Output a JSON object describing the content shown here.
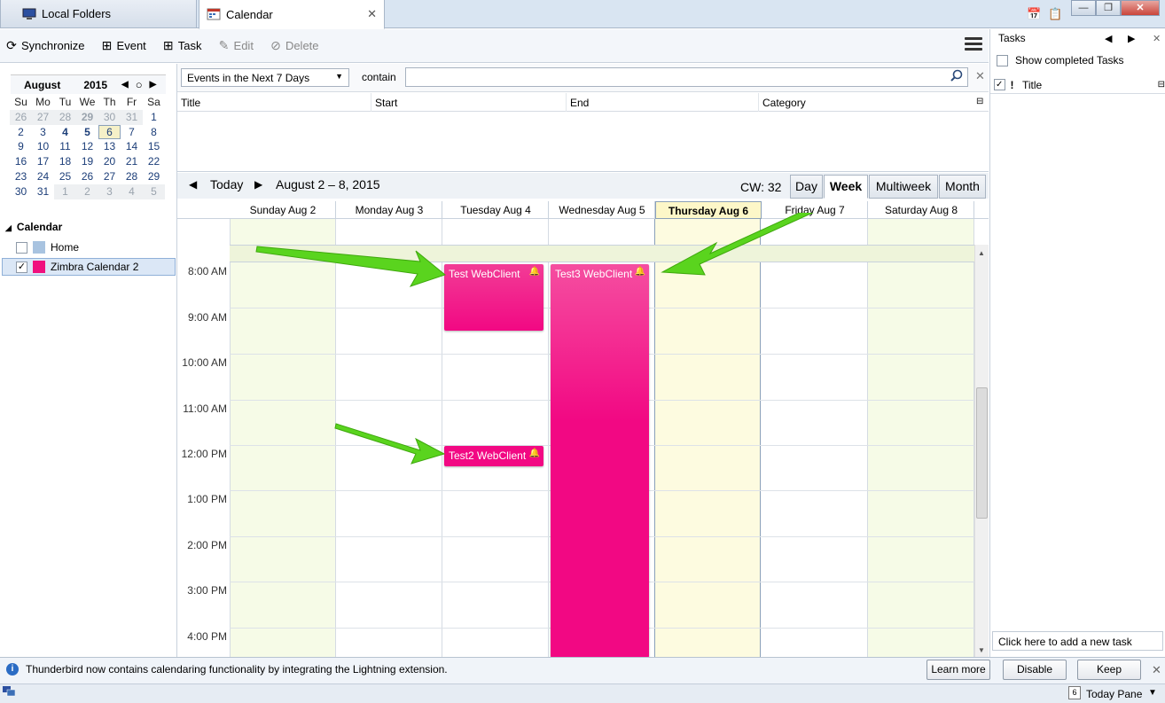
{
  "tabs": [
    {
      "label": "Local Folders",
      "icon": "computer-icon"
    },
    {
      "label": "Calendar",
      "icon": "calendar-icon"
    }
  ],
  "toolbar": {
    "synchronize": "Synchronize",
    "event": "Event",
    "task": "Task",
    "edit": "Edit",
    "delete": "Delete"
  },
  "minicalendar": {
    "month": "August",
    "year": "2015",
    "weekdays": [
      "Su",
      "Mo",
      "Tu",
      "We",
      "Th",
      "Fr",
      "Sa"
    ],
    "weeks": [
      [
        "26",
        "27",
        "28",
        "29",
        "30",
        "31",
        "1"
      ],
      [
        "2",
        "3",
        "4",
        "5",
        "6",
        "7",
        "8"
      ],
      [
        "9",
        "10",
        "11",
        "12",
        "13",
        "14",
        "15"
      ],
      [
        "16",
        "17",
        "18",
        "19",
        "20",
        "21",
        "22"
      ],
      [
        "23",
        "24",
        "25",
        "26",
        "27",
        "28",
        "29"
      ],
      [
        "30",
        "31",
        "1",
        "2",
        "3",
        "4",
        "5"
      ]
    ],
    "today": "6"
  },
  "calendars": {
    "header": "Calendar",
    "items": [
      {
        "name": "Home",
        "color": "#a8c3e0",
        "checked": false
      },
      {
        "name": "Zimbra Calendar 2",
        "color": "#f0107e",
        "checked": true
      }
    ]
  },
  "filter": {
    "selected": "Events in the Next 7 Days",
    "contain_label": "contain",
    "search_value": ""
  },
  "list_columns": [
    "Title",
    "Start",
    "End",
    "Category"
  ],
  "nav": {
    "today_label": "Today",
    "range": "August 2 – 8, 2015",
    "cw": "CW: 32",
    "views": [
      "Day",
      "Week",
      "Multiweek",
      "Month"
    ],
    "selected_view": "Week"
  },
  "days": [
    "Sunday Aug 2",
    "Monday Aug 3",
    "Tuesday Aug 4",
    "Wednesday Aug 5",
    "Thursday Aug 6",
    "Friday Aug 7",
    "Saturday Aug 8"
  ],
  "times": [
    "8:00 AM",
    "9:00 AM",
    "10:00 AM",
    "11:00 AM",
    "12:00 PM",
    "1:00 PM",
    "2:00 PM",
    "3:00 PM",
    "4:00 PM"
  ],
  "events": [
    {
      "title": "Test WebClient",
      "day": "Tuesday Aug 4",
      "start": "8:00 AM",
      "end": "9:30 AM"
    },
    {
      "title": "Test2 WebClient",
      "day": "Tuesday Aug 4",
      "start": "12:00 PM",
      "end": "12:30 PM"
    },
    {
      "title": "Test3 WebClient",
      "day": "Wednesday Aug 5",
      "start": "8:00 AM",
      "end": "after 4:00 PM"
    }
  ],
  "tasks": {
    "title": "Tasks",
    "show_completed": "Show completed Tasks",
    "col_priority": "!",
    "col_title": "Title",
    "add_placeholder": "Click here to add a new task"
  },
  "notification": {
    "text": "Thunderbird now contains calendaring functionality by integrating the Lightning extension.",
    "learn_more": "Learn more",
    "disable": "Disable",
    "keep": "Keep"
  },
  "status": {
    "today_pane": "Today Pane",
    "today_icon_day": "6"
  }
}
